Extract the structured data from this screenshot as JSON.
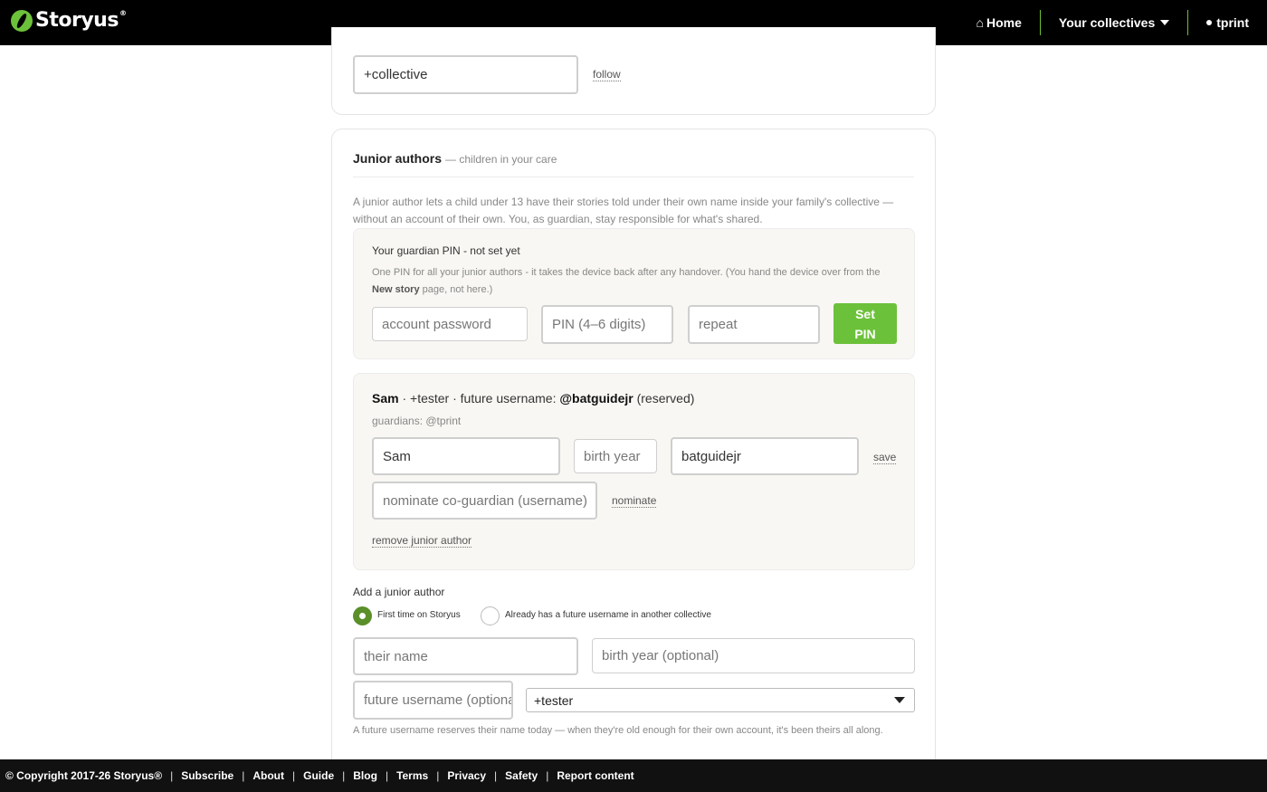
{
  "header": {
    "brand": "Storyus",
    "brand_mark": "®",
    "nav": {
      "home": "Home",
      "collectives": "Your collectives",
      "user": "tprint"
    }
  },
  "follow_card": {
    "collective_input_value": "+collective",
    "follow_label": "follow"
  },
  "junior_authors": {
    "title": "Junior authors",
    "subtitle": "— children in your care",
    "intro": "A junior author lets a child under 13 have their stories told under their own name inside your family's collective — without an account of their own. You, as guardian, stay responsible for what's shared.",
    "pin": {
      "heading": "Your guardian PIN - not set yet",
      "desc_before": "One PIN for all your junior authors - it takes the device back after any handover. (You hand the device over from the ",
      "desc_bold": "New story",
      "desc_after": " page, not here.)",
      "password_placeholder": "account password",
      "pin_placeholder": "PIN (4–6 digits)",
      "repeat_placeholder": "repeat",
      "set_line1": "Set",
      "set_line2": "PIN"
    },
    "junior": {
      "name": "Sam",
      "collective": "· +tester · future username:",
      "username_display": "@batguidejr",
      "reserved": "(reserved)",
      "guardians": "guardians: @tprint",
      "name_value": "Sam",
      "birth_placeholder": "birth year",
      "username_value": "batguidejr",
      "save_label": "save",
      "coguardian_placeholder": "nominate co-guardian (username)",
      "nominate_label": "nominate",
      "remove_label": "remove junior author"
    },
    "add": {
      "heading": "Add a junior author",
      "radio_first": "First time on Storyus",
      "radio_existing": "Already has a future username in another collective",
      "name_placeholder": "their name",
      "birth_placeholder": "birth year (optional)",
      "future_placeholder": "future username (optional)",
      "collective_selected": "+tester",
      "note": "A future username reserves their name today — when they're old enough for their own account, it's been theirs all along."
    }
  },
  "footer": {
    "copyright": "© Copyright 2017-26 Storyus®",
    "links": [
      "Subscribe",
      "About",
      "Guide",
      "Blog",
      "Terms",
      "Privacy",
      "Safety",
      "Report content"
    ]
  },
  "colors": {
    "accent": "#6cc13a",
    "topbar": "#000000",
    "footer": "#111111",
    "radio_on": "#5a8f2a"
  },
  "icons": [
    "home-icon",
    "chevron-down-icon",
    "status-dot-icon",
    "dropdown-arrow-icon",
    "logo-icon"
  ]
}
